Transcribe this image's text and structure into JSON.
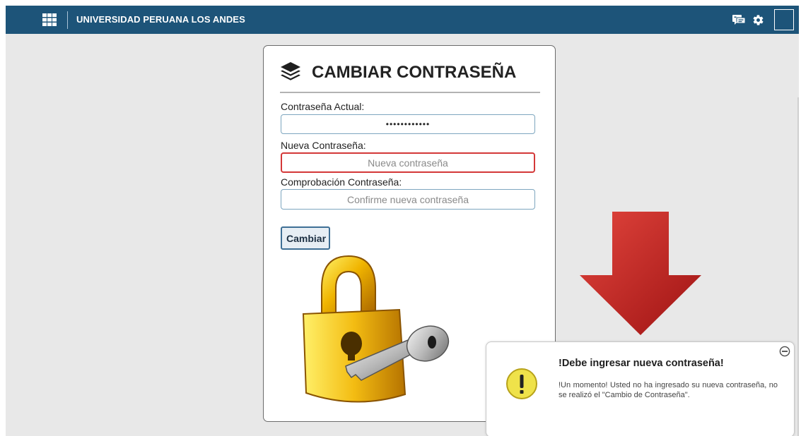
{
  "header": {
    "brand": "UNIVERSIDAD PERUANA LOS ANDES",
    "icons": [
      "apps-grid-icon",
      "chat-icon",
      "gear-icon"
    ],
    "background_color": "#1d5479"
  },
  "form": {
    "title": "CAMBIAR CONTRASEÑA",
    "current_password_label": "Contraseña Actual:",
    "current_password_value": "••••••••••••",
    "new_password_label": "Nueva Contraseña:",
    "new_password_placeholder": "Nueva contraseña",
    "confirm_password_label": "Comprobación Contraseña:",
    "confirm_password_placeholder": "Confirme nueva contraseña",
    "submit_label": "Cambiar",
    "error_border_color": "#d43838"
  },
  "notification": {
    "title": "!Debe ingresar nueva contraseña!",
    "message": "!Un momento! Usted no ha ingresado su nueva contraseña, no se realizó el \"Cambio de Contraseña\".",
    "icon": "warning-icon",
    "accent_color": "#d9d21c"
  },
  "annotation": {
    "arrow_color": "#c62828"
  }
}
